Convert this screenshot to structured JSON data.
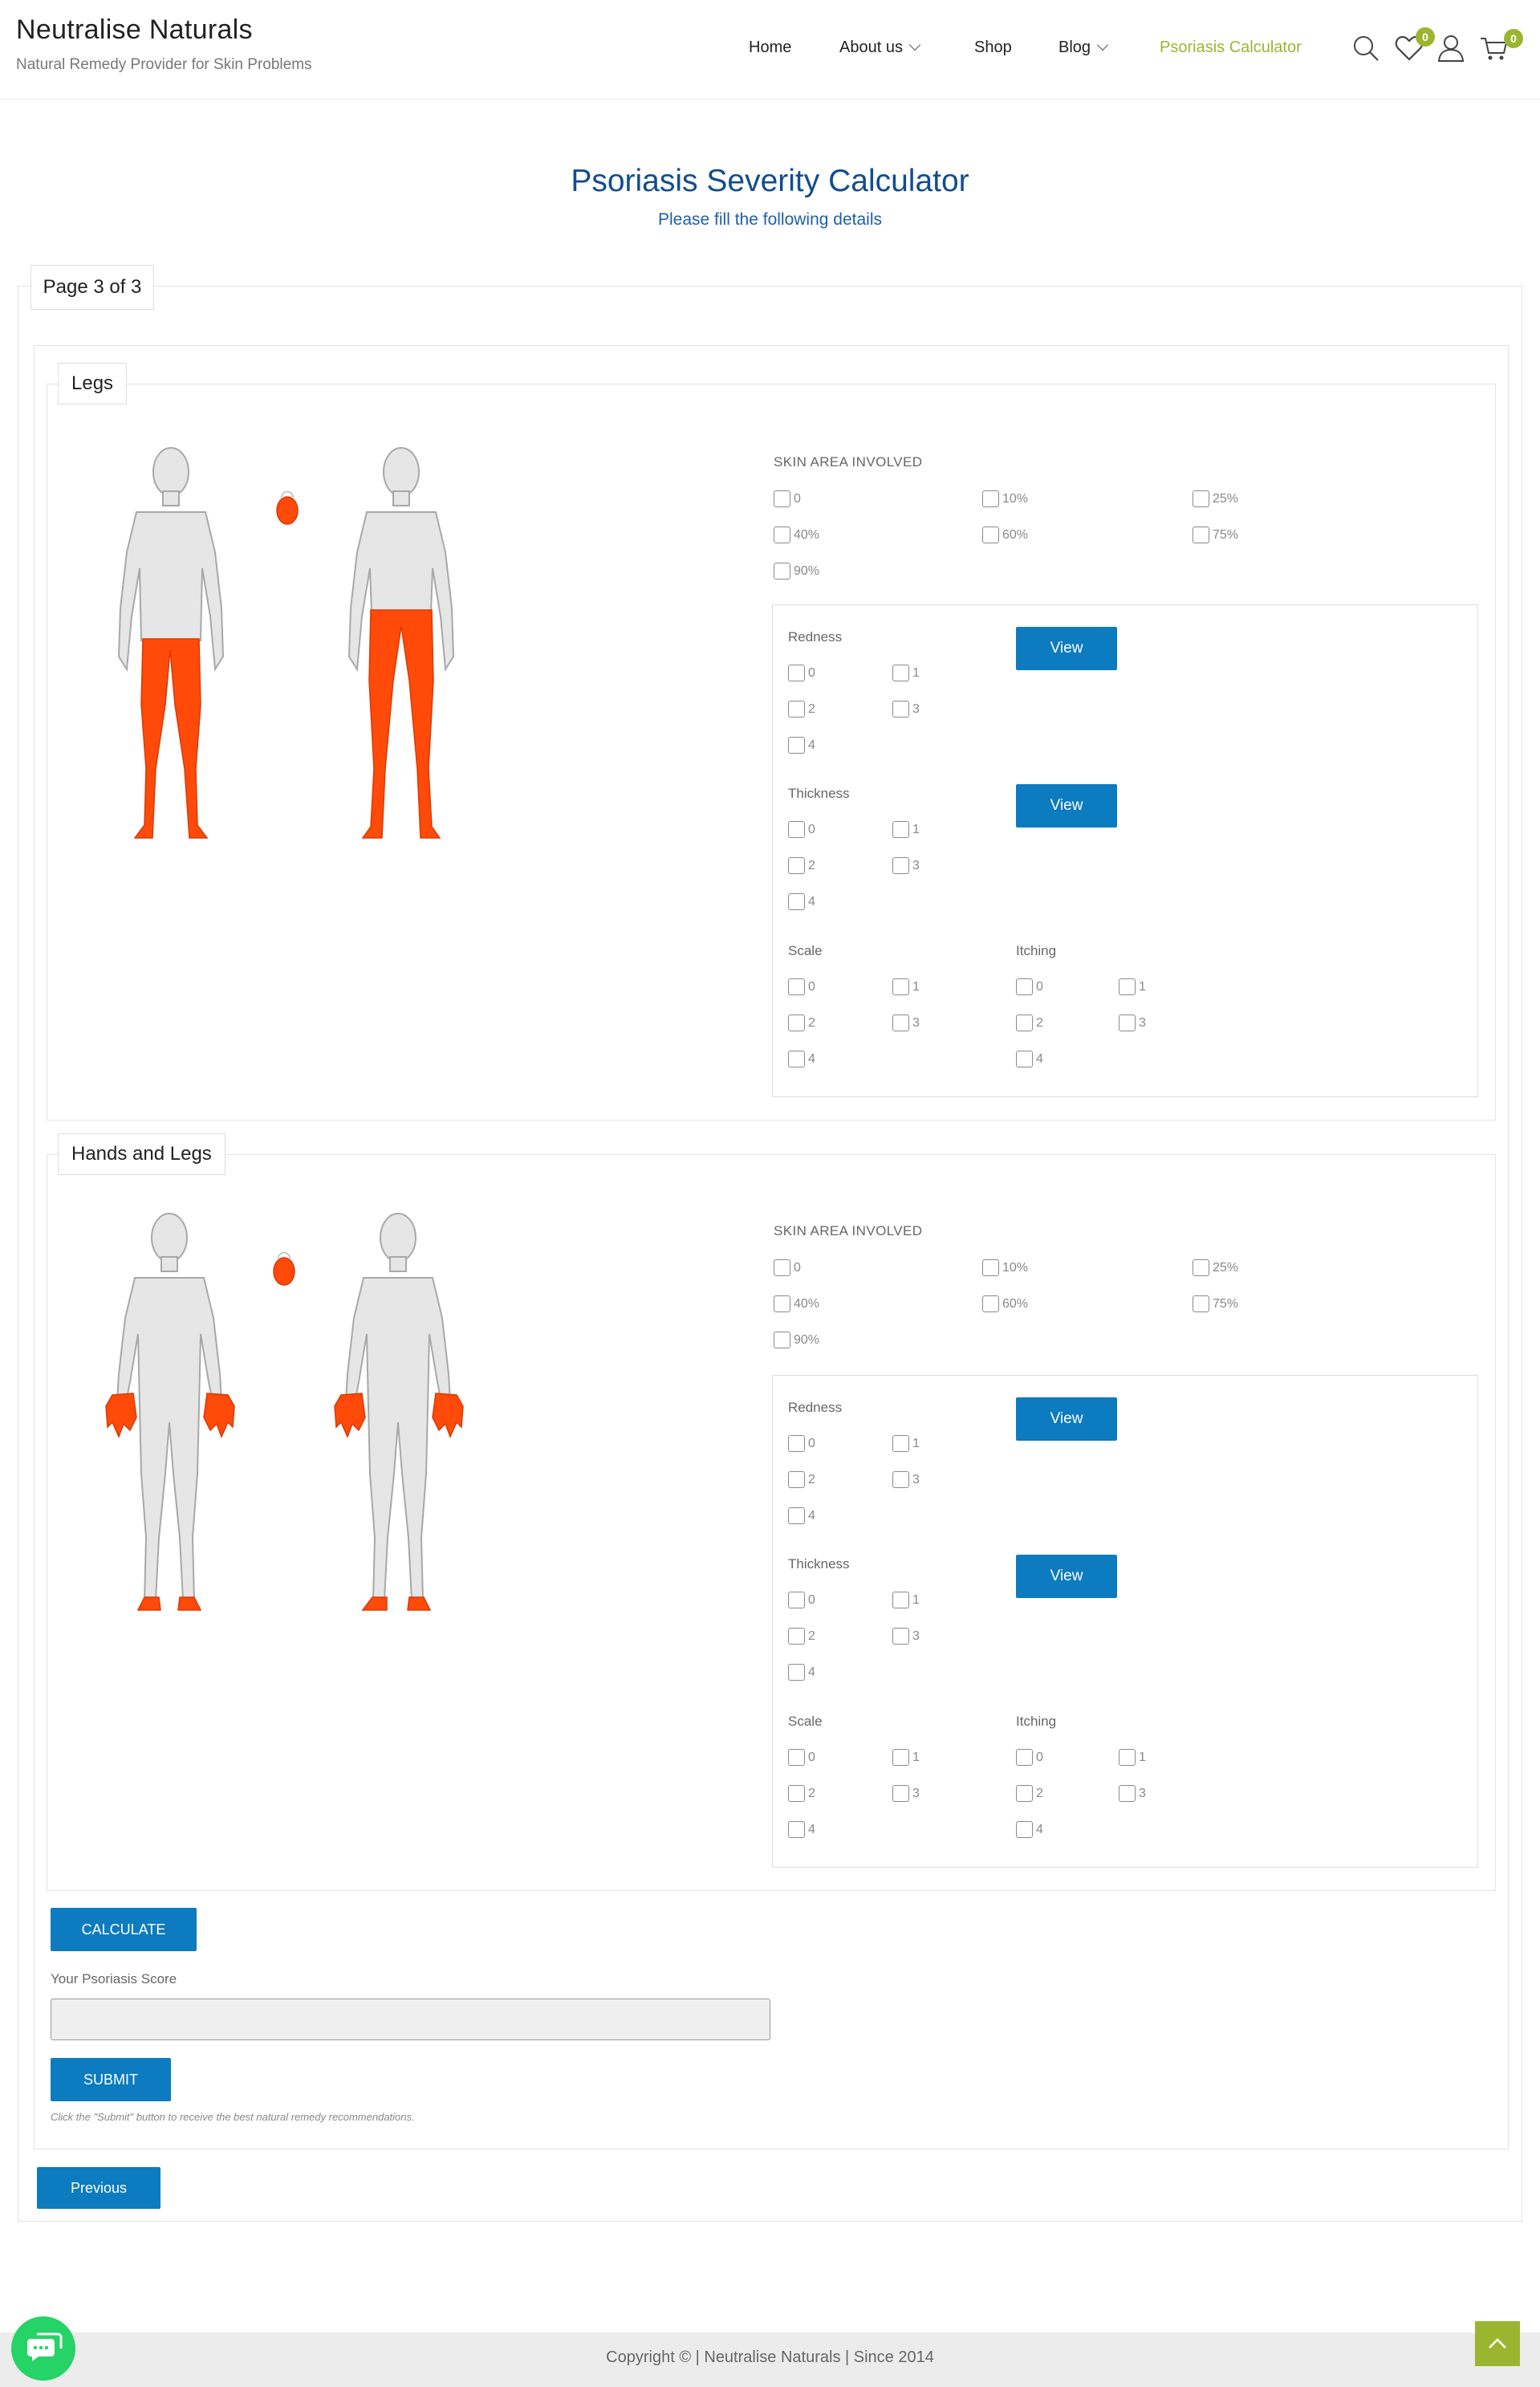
{
  "header": {
    "brand": "Neutralise Naturals",
    "tagline": "Natural Remedy Provider for Skin Problems",
    "nav": [
      "Home",
      "About us",
      "Shop",
      "Blog",
      "Psoriasis Calculator"
    ],
    "wishlist_count": "0",
    "cart_count": "0"
  },
  "title": "Psoriasis Severity Calculator",
  "subtitle": "Please fill the following details",
  "page_indicator": "Page 3 of 3",
  "sections": [
    {
      "legend": "Legs",
      "skin_area_label": "SKIN AREA INVOLVED",
      "skin_area_options": [
        "0",
        "10%",
        "25%",
        "40%",
        "60%",
        "75%",
        "90%"
      ],
      "redness_label": "Redness",
      "thickness_label": "Thickness",
      "scale_label": "Scale",
      "itching_label": "Itching",
      "score_options": [
        "0",
        "1",
        "2",
        "3",
        "4"
      ],
      "view_label": "View"
    },
    {
      "legend": "Hands and Legs",
      "skin_area_label": "SKIN AREA INVOLVED",
      "skin_area_options": [
        "0",
        "10%",
        "25%",
        "40%",
        "60%",
        "75%",
        "90%"
      ],
      "redness_label": "Redness",
      "thickness_label": "Thickness",
      "scale_label": "Scale",
      "itching_label": "Itching",
      "score_options": [
        "0",
        "1",
        "2",
        "3",
        "4"
      ],
      "view_label": "View"
    }
  ],
  "calculate_label": "CALCULATE",
  "score_label": "Your Psoriasis Score",
  "submit_label": "SUBMIT",
  "submit_note": "Click the \"Submit\" button to receive the best natural remedy recommendations.",
  "previous_label": "Previous",
  "footer": {
    "copyright": "Copyright © | Neutralise Naturals | Since 2014"
  },
  "colors": {
    "accent_green": "#9bb531",
    "button_blue": "#0c7bbf",
    "title_blue": "#124d8e",
    "highlight_orange": "#ff4a0a"
  }
}
